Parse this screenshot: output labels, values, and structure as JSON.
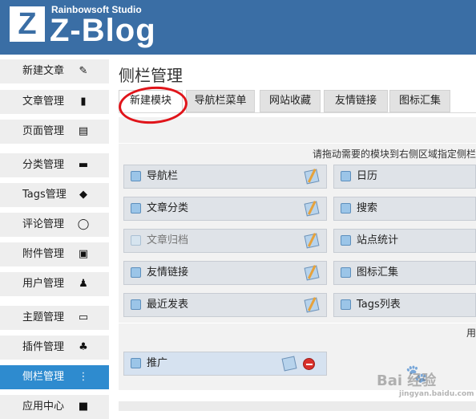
{
  "header": {
    "studio": "Rainbowsoft Studio",
    "logo_letter": "Z",
    "brand": "Z-Blog",
    "bg_color": "#3a6ea5"
  },
  "sidebar": {
    "active_color": "#2e8bcf",
    "items": [
      {
        "label": "新建文章",
        "icon": "edit-doc-icon",
        "glyph": "✎"
      },
      {
        "label": "文章管理",
        "icon": "book-icon",
        "glyph": "▮"
      },
      {
        "label": "页面管理",
        "icon": "page-icon",
        "glyph": "▤"
      },
      {
        "label": "分类管理",
        "icon": "folder-icon",
        "glyph": "▬"
      },
      {
        "label": "Tags管理",
        "icon": "tag-icon",
        "glyph": "◆"
      },
      {
        "label": "评论管理",
        "icon": "comment-icon",
        "glyph": "◯"
      },
      {
        "label": "附件管理",
        "icon": "attachment-icon",
        "glyph": "▣"
      },
      {
        "label": "用户管理",
        "icon": "user-icon",
        "glyph": "♟"
      },
      {
        "label": "主题管理",
        "icon": "monitor-icon",
        "glyph": "▭"
      },
      {
        "label": "插件管理",
        "icon": "plugin-icon",
        "glyph": "♣"
      },
      {
        "label": "侧栏管理",
        "icon": "sidebar-icon",
        "glyph": "⋮",
        "active": true
      },
      {
        "label": "应用中心",
        "icon": "app-center-icon",
        "glyph": "■"
      }
    ]
  },
  "main": {
    "title": "侧栏管理",
    "tabs": [
      "新建模块",
      "导航栏菜单",
      "网站收藏",
      "友情链接",
      "图标汇集"
    ],
    "hint": "请拖动需要的模块到右侧区域指定侧栏",
    "modules_left": [
      "导航栏",
      "文章分类",
      "文章归档",
      "友情链接",
      "最近发表"
    ],
    "modules_right": [
      "日历",
      "搜索",
      "站点统计",
      "图标汇集",
      "Tags列表"
    ],
    "user_section_text": "用",
    "user_module": "推广"
  },
  "watermark": {
    "text": "Bai 经验",
    "sub": "jingyan.baidu.com"
  }
}
